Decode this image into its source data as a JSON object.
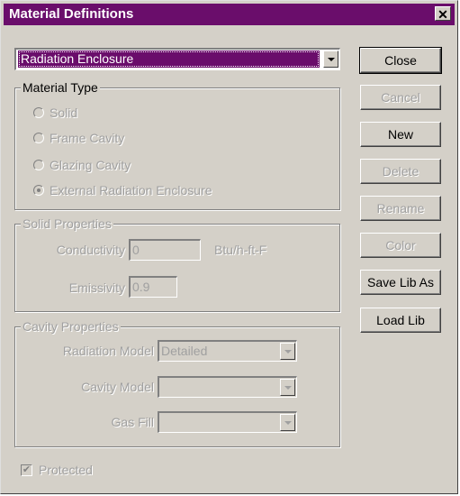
{
  "window": {
    "title": "Material Definitions",
    "close_glyph": "✕"
  },
  "material_select": {
    "value": "Radiation Enclosure"
  },
  "material_type": {
    "legend": "Material Type",
    "options": [
      "Solid",
      "Frame Cavity",
      "Glazing Cavity",
      "External Radiation Enclosure"
    ],
    "selected_index": 3
  },
  "solid_properties": {
    "legend": "Solid Properties",
    "conductivity_label": "Conductivity",
    "conductivity_value": "0",
    "conductivity_unit": "Btu/h-ft-F",
    "emissivity_label": "Emissivity",
    "emissivity_value": "0.9"
  },
  "cavity_properties": {
    "legend": "Cavity Properties",
    "radiation_model_label": "Radiation Model",
    "radiation_model_value": "Detailed",
    "cavity_model_label": "Cavity Model",
    "cavity_model_value": "",
    "gas_fill_label": "Gas Fill",
    "gas_fill_value": ""
  },
  "protected": {
    "label": "Protected",
    "checked": true
  },
  "buttons": {
    "close": "Close",
    "cancel": "Cancel",
    "new": "New",
    "delete": "Delete",
    "rename": "Rename",
    "color": "Color",
    "save_lib_as": "Save Lib As",
    "load_lib": "Load Lib"
  },
  "colors": {
    "titlebar": "#6a0d6b",
    "selection": "#6a0d6b",
    "face": "#d4d0c8",
    "disabled_text": "#a0a0a0"
  }
}
